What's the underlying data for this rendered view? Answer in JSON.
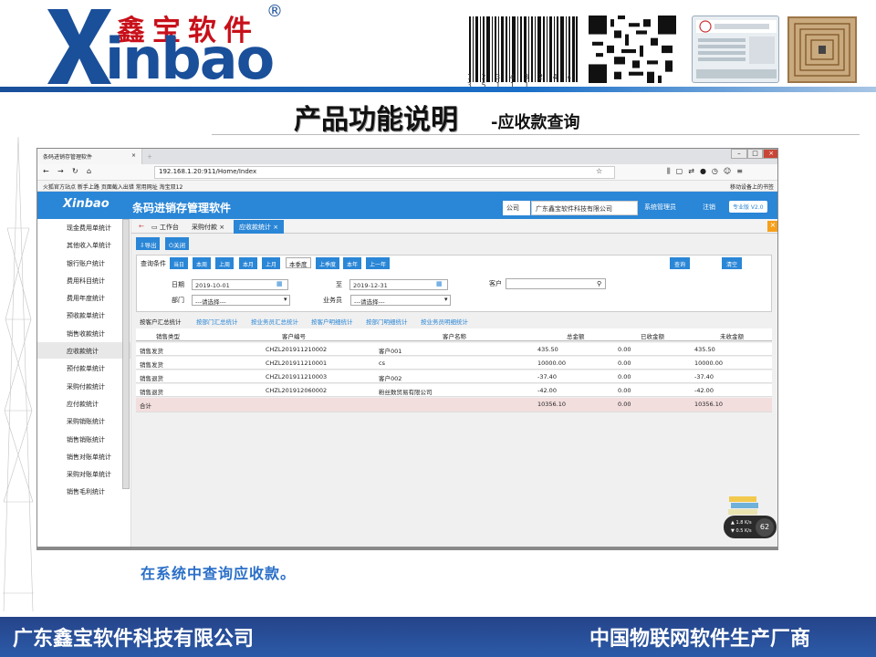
{
  "slide": {
    "logo_cn": "鑫宝软件",
    "logo_en": "inbao",
    "logo_reg": "®",
    "barcode_number": "1 2 3 4 3 2 4 4 3 5 1 1 1",
    "title": "产品功能说明",
    "subtitle": "-应收款查询",
    "caption": "在系统中查询应收款。",
    "footer_left": "广东鑫宝软件科技有限公司",
    "footer_right": "中国物联网软件生产厂商",
    "brand_color": "#1a4f9a"
  },
  "browser": {
    "tab_title": "条码进销存管理软件",
    "tab_close": "×",
    "url": "192.168.1.20:911/Home/Index",
    "bookmarks": "火狐官方站点  新手上路  页面截入出错  常用网址  淘宝双12",
    "bookmarks_right": "移动设备上的书签"
  },
  "app": {
    "logo": "Xinbao",
    "title": "条码进销存管理软件",
    "company_label": "公司",
    "company_value": "广东鑫宝软件科技有限公司",
    "user": "系统管理员",
    "logout": "注销",
    "version": "专业版 V2.0",
    "accent": "#2a86d6"
  },
  "sidebar": {
    "items": [
      "现金费用单统计",
      "其他收入单统计",
      "银行账户统计",
      "费用科目统计",
      "费用年度统计",
      "预收款单统计",
      "销售收款统计",
      "应收款统计",
      "预付款单统计",
      "采购付款统计",
      "应付款统计",
      "采购销账统计",
      "销售销账统计",
      "销售对账单统计",
      "采购对账单统计",
      "销售毛利统计"
    ],
    "active_index": 7
  },
  "tabs": {
    "workbench": "工作台",
    "tab1": "采购付款",
    "tab2": "应收款统计"
  },
  "toolbar": {
    "export": "导出",
    "close": "关闭"
  },
  "filter": {
    "cond_label": "查询条件",
    "quick": [
      "当日",
      "本周",
      "上周",
      "本月",
      "上月",
      "本季度",
      "上季度",
      "本年",
      "上一年"
    ],
    "quick_selected": "本季度",
    "search": "查询",
    "clear": "清空",
    "date_label": "日期",
    "date_from": "2019-10-01",
    "to_label": "至",
    "date_to": "2019-12-31",
    "customer_label": "客户",
    "dept_label": "部门",
    "dept_value": "---请选择---",
    "clerk_label": "业务员",
    "clerk_value": "---请选择---"
  },
  "subtabs": [
    "按客户汇总统计",
    "按部门汇总统计",
    "按业务员汇总统计",
    "按客户明细统计",
    "按部门明细统计",
    "按业务员明细统计"
  ],
  "grid": {
    "headers": [
      "销售类型",
      "客户编号",
      "客户名称",
      "总金额",
      "已收金额",
      "未收金额"
    ],
    "rows": [
      [
        "销售发货",
        "CHZL201911210002",
        "客户001",
        "435.50",
        "0.00",
        "435.50"
      ],
      [
        "销售发货",
        "CHZL201911210001",
        "cs",
        "10000.00",
        "0.00",
        "10000.00"
      ],
      [
        "销售退货",
        "CHZL201911210003",
        "客户002",
        "-37.40",
        "0.00",
        "-37.40"
      ],
      [
        "销售退货",
        "CHZL201912060002",
        "粉丝数贸易有限公司",
        "-42.00",
        "0.00",
        "-42.00"
      ]
    ],
    "total": [
      "合计",
      "",
      "",
      "10356.10",
      "0.00",
      "10356.10"
    ]
  },
  "widget": {
    "up": "1.8",
    "down": "0.5",
    "unit": "K/s",
    "percent": "62"
  }
}
